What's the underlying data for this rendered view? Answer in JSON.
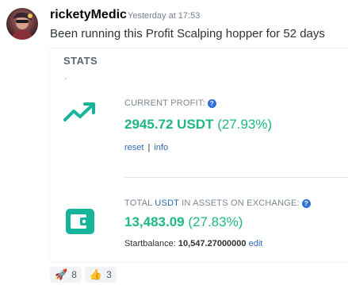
{
  "message": {
    "username": "ricketyMedic",
    "timestamp": "Yesterday at 17:53",
    "text": "Been running this Profit Scalping hopper for 52 days"
  },
  "card": {
    "title": "STATS",
    "profit": {
      "label": "CURRENT PROFIT:",
      "amount": "2945.72 USDT",
      "percent": "(27.93%)",
      "reset_label": "reset",
      "separator": "|",
      "info_label": "info",
      "icon": "trend-up-icon"
    },
    "assets": {
      "label_prefix": "TOTAL",
      "label_currency": "USDT",
      "label_suffix": "IN ASSETS ON EXCHANGE:",
      "amount": "13,483.09",
      "percent": "(27.83%)",
      "start_label": "Startbalance:",
      "start_value": "10,547.27000000",
      "edit_label": "edit",
      "icon": "wallet-icon"
    },
    "help_glyph": "?"
  },
  "reactions": [
    {
      "emoji": "rocket",
      "count": "8"
    },
    {
      "emoji": "thumbs-up",
      "count": "3"
    }
  ],
  "colors": {
    "accent_green": "#1db981",
    "link_blue": "#2c69b5",
    "help_blue": "#2f6fd6",
    "icon_teal": "#16b59b"
  }
}
